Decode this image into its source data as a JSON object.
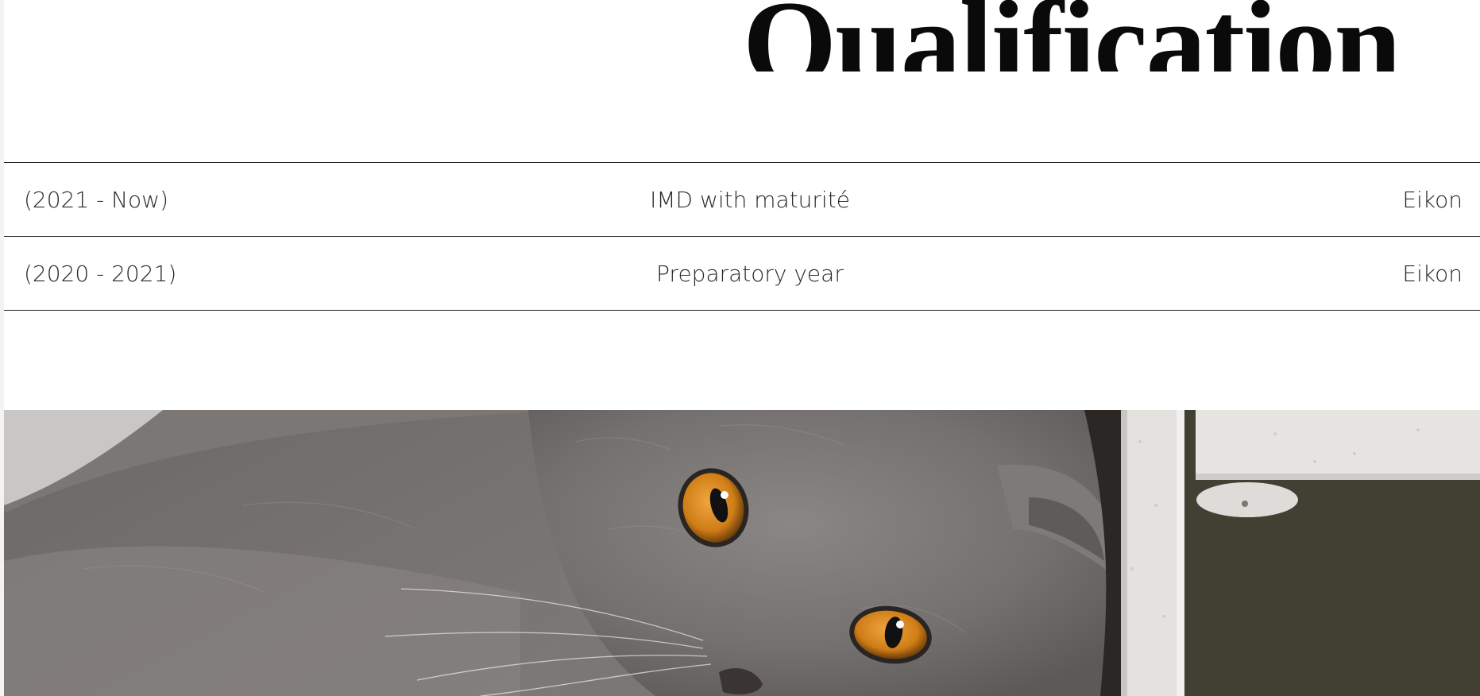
{
  "section": {
    "title": "Qualification"
  },
  "qualifications": [
    {
      "period": "(2021 - Now)",
      "program": "IMD with maturité",
      "school": "Eikon"
    },
    {
      "period": "(2020 - 2021)",
      "program": "Preparatory year",
      "school": "Eikon"
    }
  ],
  "photo": {
    "subject": "grey-cat-photo",
    "colors": {
      "fur": "#7a7674",
      "eyes": "#d98a1f",
      "frame": "#e6e6e4",
      "dark_bg": "#3f3d30"
    }
  }
}
